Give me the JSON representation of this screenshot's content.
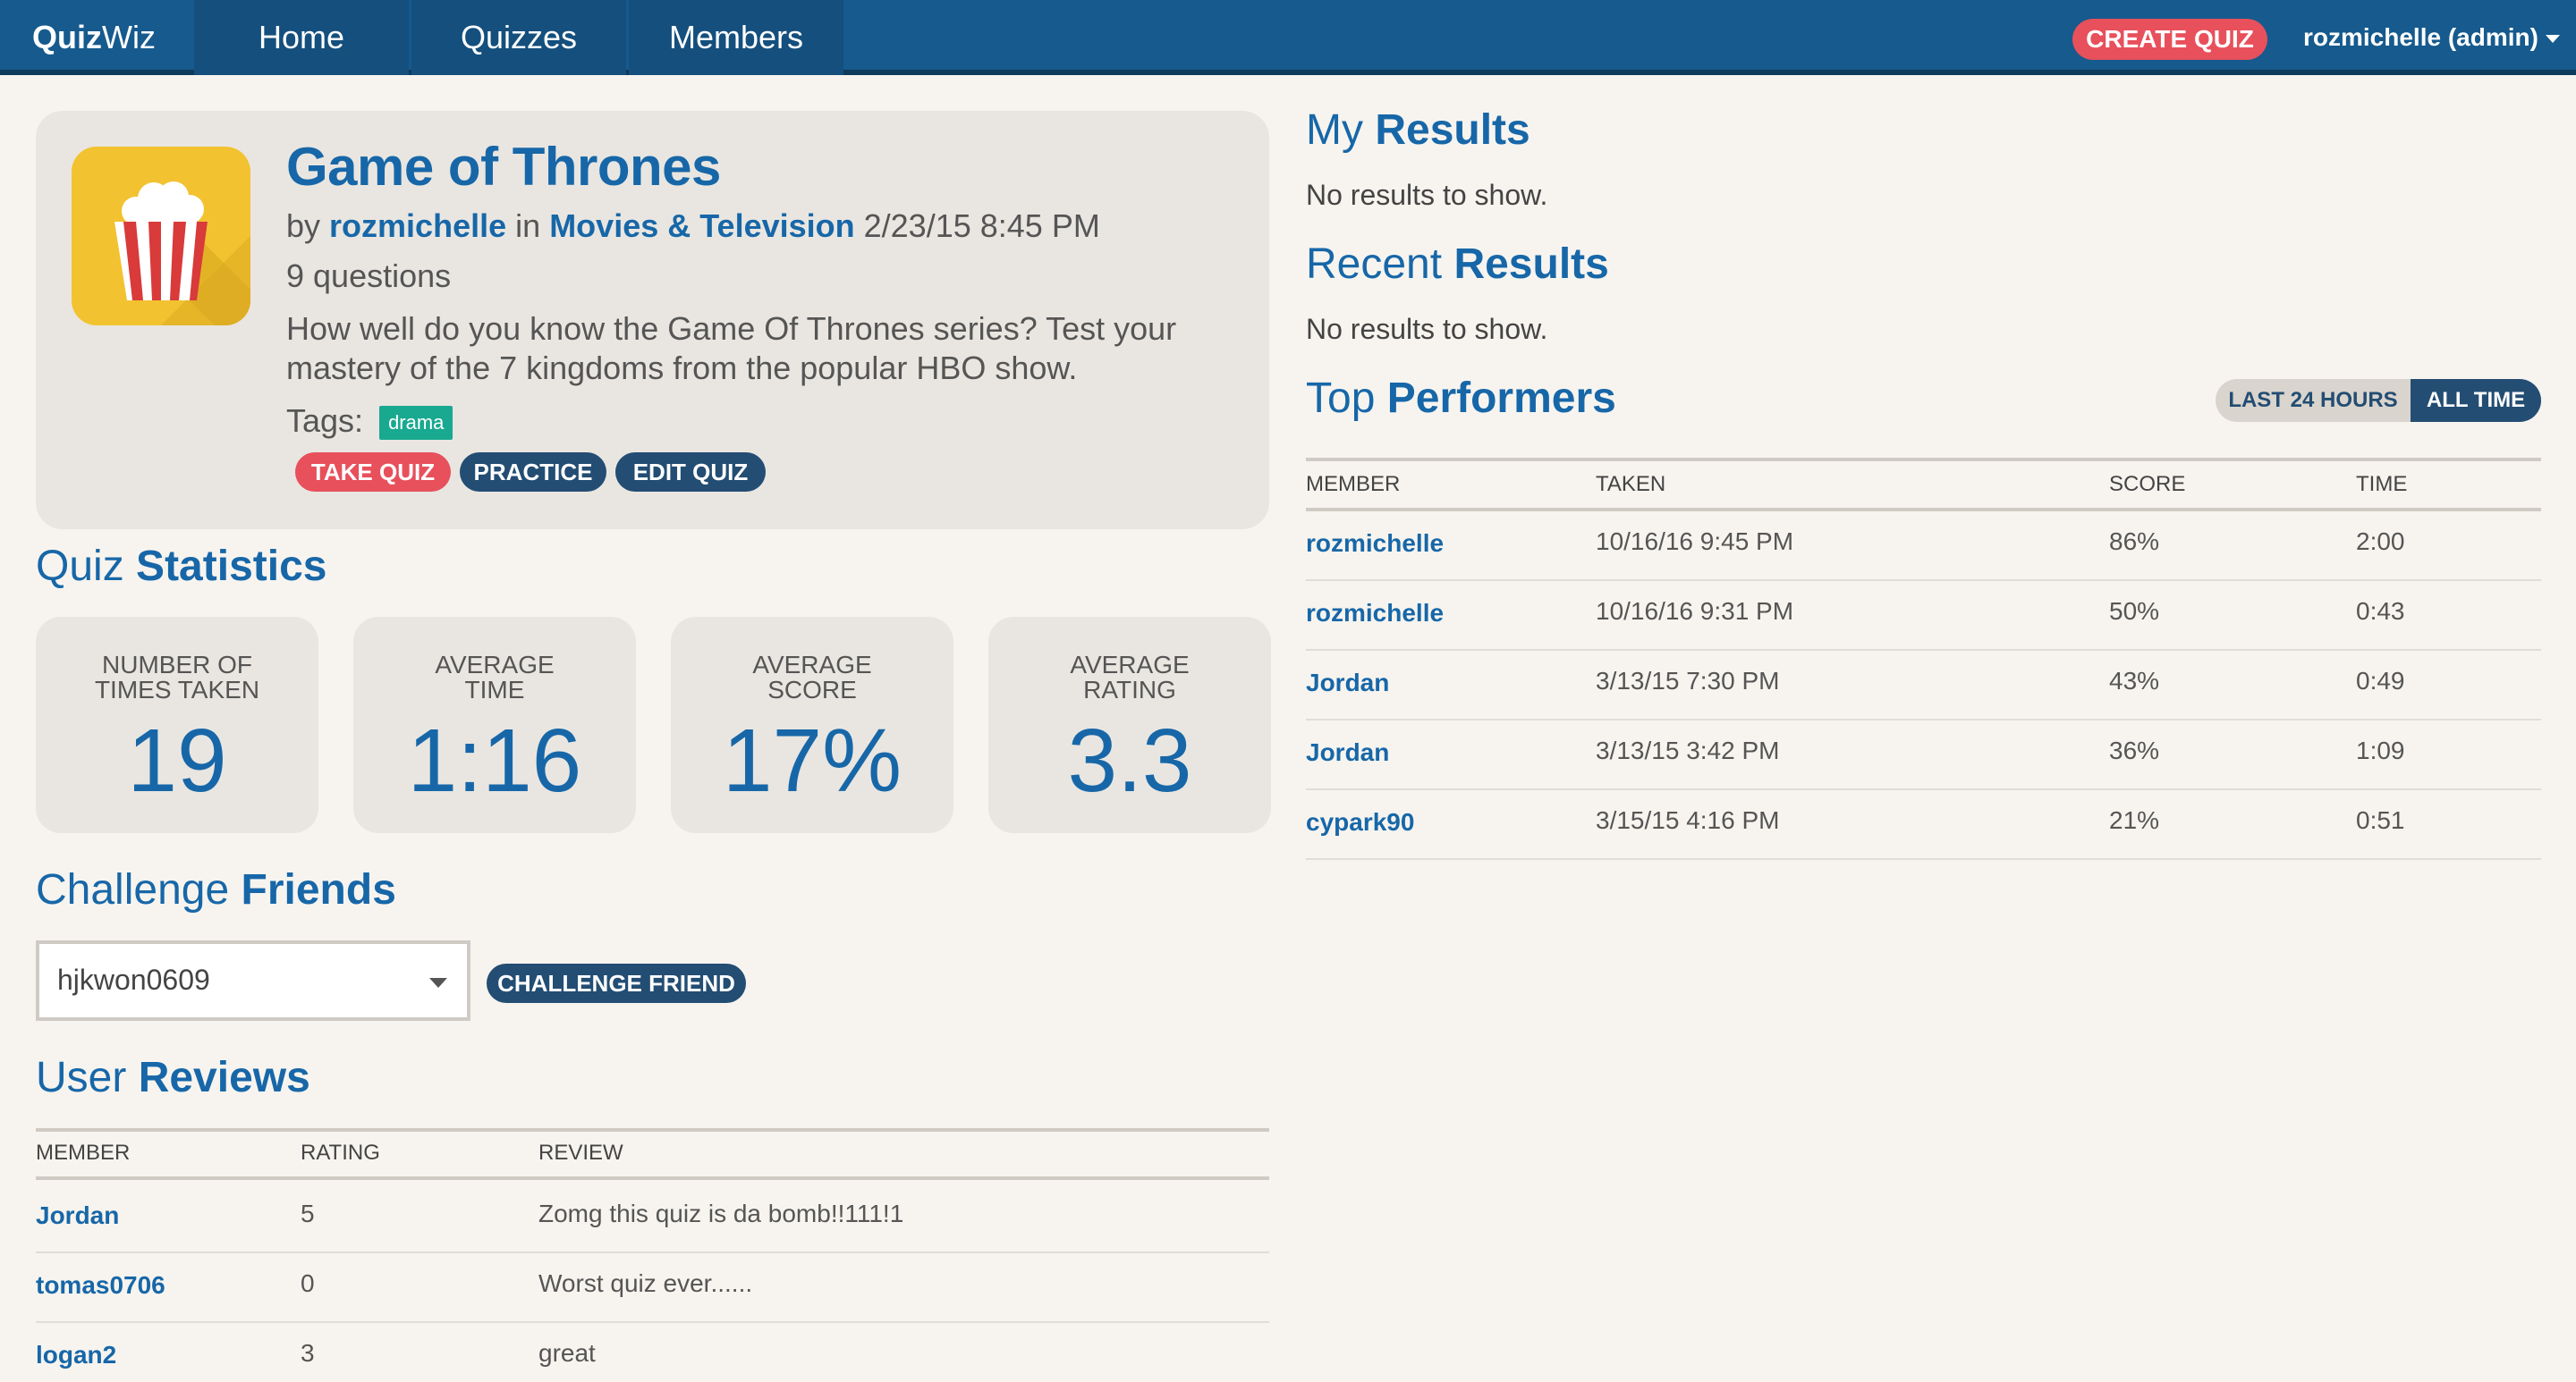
{
  "nav": {
    "brand_bold": "Quiz",
    "brand_light": "Wiz",
    "links": [
      "Home",
      "Quizzes",
      "Members"
    ],
    "create_label": "CREATE QUIZ",
    "user_label": "rozmichelle (admin)",
    "bg_color": "#165a8e"
  },
  "quiz": {
    "title": "Game of Thrones",
    "by": "by",
    "author": "rozmichelle",
    "in": "in",
    "category": "Movies & Television",
    "date": "2/23/15 8:45 PM",
    "question_count": "9 questions",
    "description": "How well do you know the Game Of Thrones series? Test your mastery of the 7 kingdoms from the popular HBO show.",
    "tags_label": "Tags:",
    "tags": [
      "drama"
    ],
    "icon": "popcorn-icon",
    "buttons": {
      "take": "TAKE QUIZ",
      "practice": "PRACTICE",
      "edit": "EDIT QUIZ"
    }
  },
  "stats": {
    "heading_light": "Quiz",
    "heading_bold": "Statistics",
    "items": [
      {
        "label_1": "NUMBER OF",
        "label_2": "TIMES TAKEN",
        "value": "19"
      },
      {
        "label_1": "AVERAGE",
        "label_2": "TIME",
        "value": "1:16"
      },
      {
        "label_1": "AVERAGE",
        "label_2": "SCORE",
        "value": "17%"
      },
      {
        "label_1": "AVERAGE",
        "label_2": "RATING",
        "value": "3.3"
      }
    ]
  },
  "challenge": {
    "heading_light": "Challenge",
    "heading_bold": "Friends",
    "selected_friend": "hjkwon0609",
    "button_label": "CHALLENGE FRIEND"
  },
  "reviews": {
    "heading_light": "User",
    "heading_bold": "Reviews",
    "columns": [
      "MEMBER",
      "RATING",
      "REVIEW"
    ],
    "rows": [
      {
        "member": "Jordan",
        "rating": "5",
        "review": "Zomg this quiz is da bomb!!111!1"
      },
      {
        "member": "tomas0706",
        "rating": "0",
        "review": "Worst quiz ever......"
      },
      {
        "member": "logan2",
        "rating": "3",
        "review": "great"
      }
    ]
  },
  "my_results": {
    "heading_light": "My",
    "heading_bold": "Results",
    "empty": "No results to show."
  },
  "recent_results": {
    "heading_light": "Recent",
    "heading_bold": "Results",
    "empty": "No results to show."
  },
  "top_performers": {
    "heading_light": "Top",
    "heading_bold": "Performers",
    "toggle": {
      "last24": "LAST 24 HOURS",
      "all_time": "ALL TIME",
      "selected": "ALL TIME"
    },
    "columns": [
      "MEMBER",
      "TAKEN",
      "SCORE",
      "TIME"
    ],
    "rows": [
      {
        "member": "rozmichelle",
        "taken": "10/16/16 9:45 PM",
        "score": "86%",
        "time": "2:00"
      },
      {
        "member": "rozmichelle",
        "taken": "10/16/16 9:31 PM",
        "score": "50%",
        "time": "0:43"
      },
      {
        "member": "Jordan",
        "taken": "3/13/15 7:30 PM",
        "score": "43%",
        "time": "0:49"
      },
      {
        "member": "Jordan",
        "taken": "3/13/15 3:42 PM",
        "score": "36%",
        "time": "1:09"
      },
      {
        "member": "cypark90",
        "taken": "3/15/15 4:16 PM",
        "score": "21%",
        "time": "0:51"
      }
    ]
  },
  "colors": {
    "accent": "#1767a8",
    "danger": "#e8505b",
    "dark_button": "#234d73",
    "tag": "#19a990",
    "background": "#f7f4ef"
  }
}
